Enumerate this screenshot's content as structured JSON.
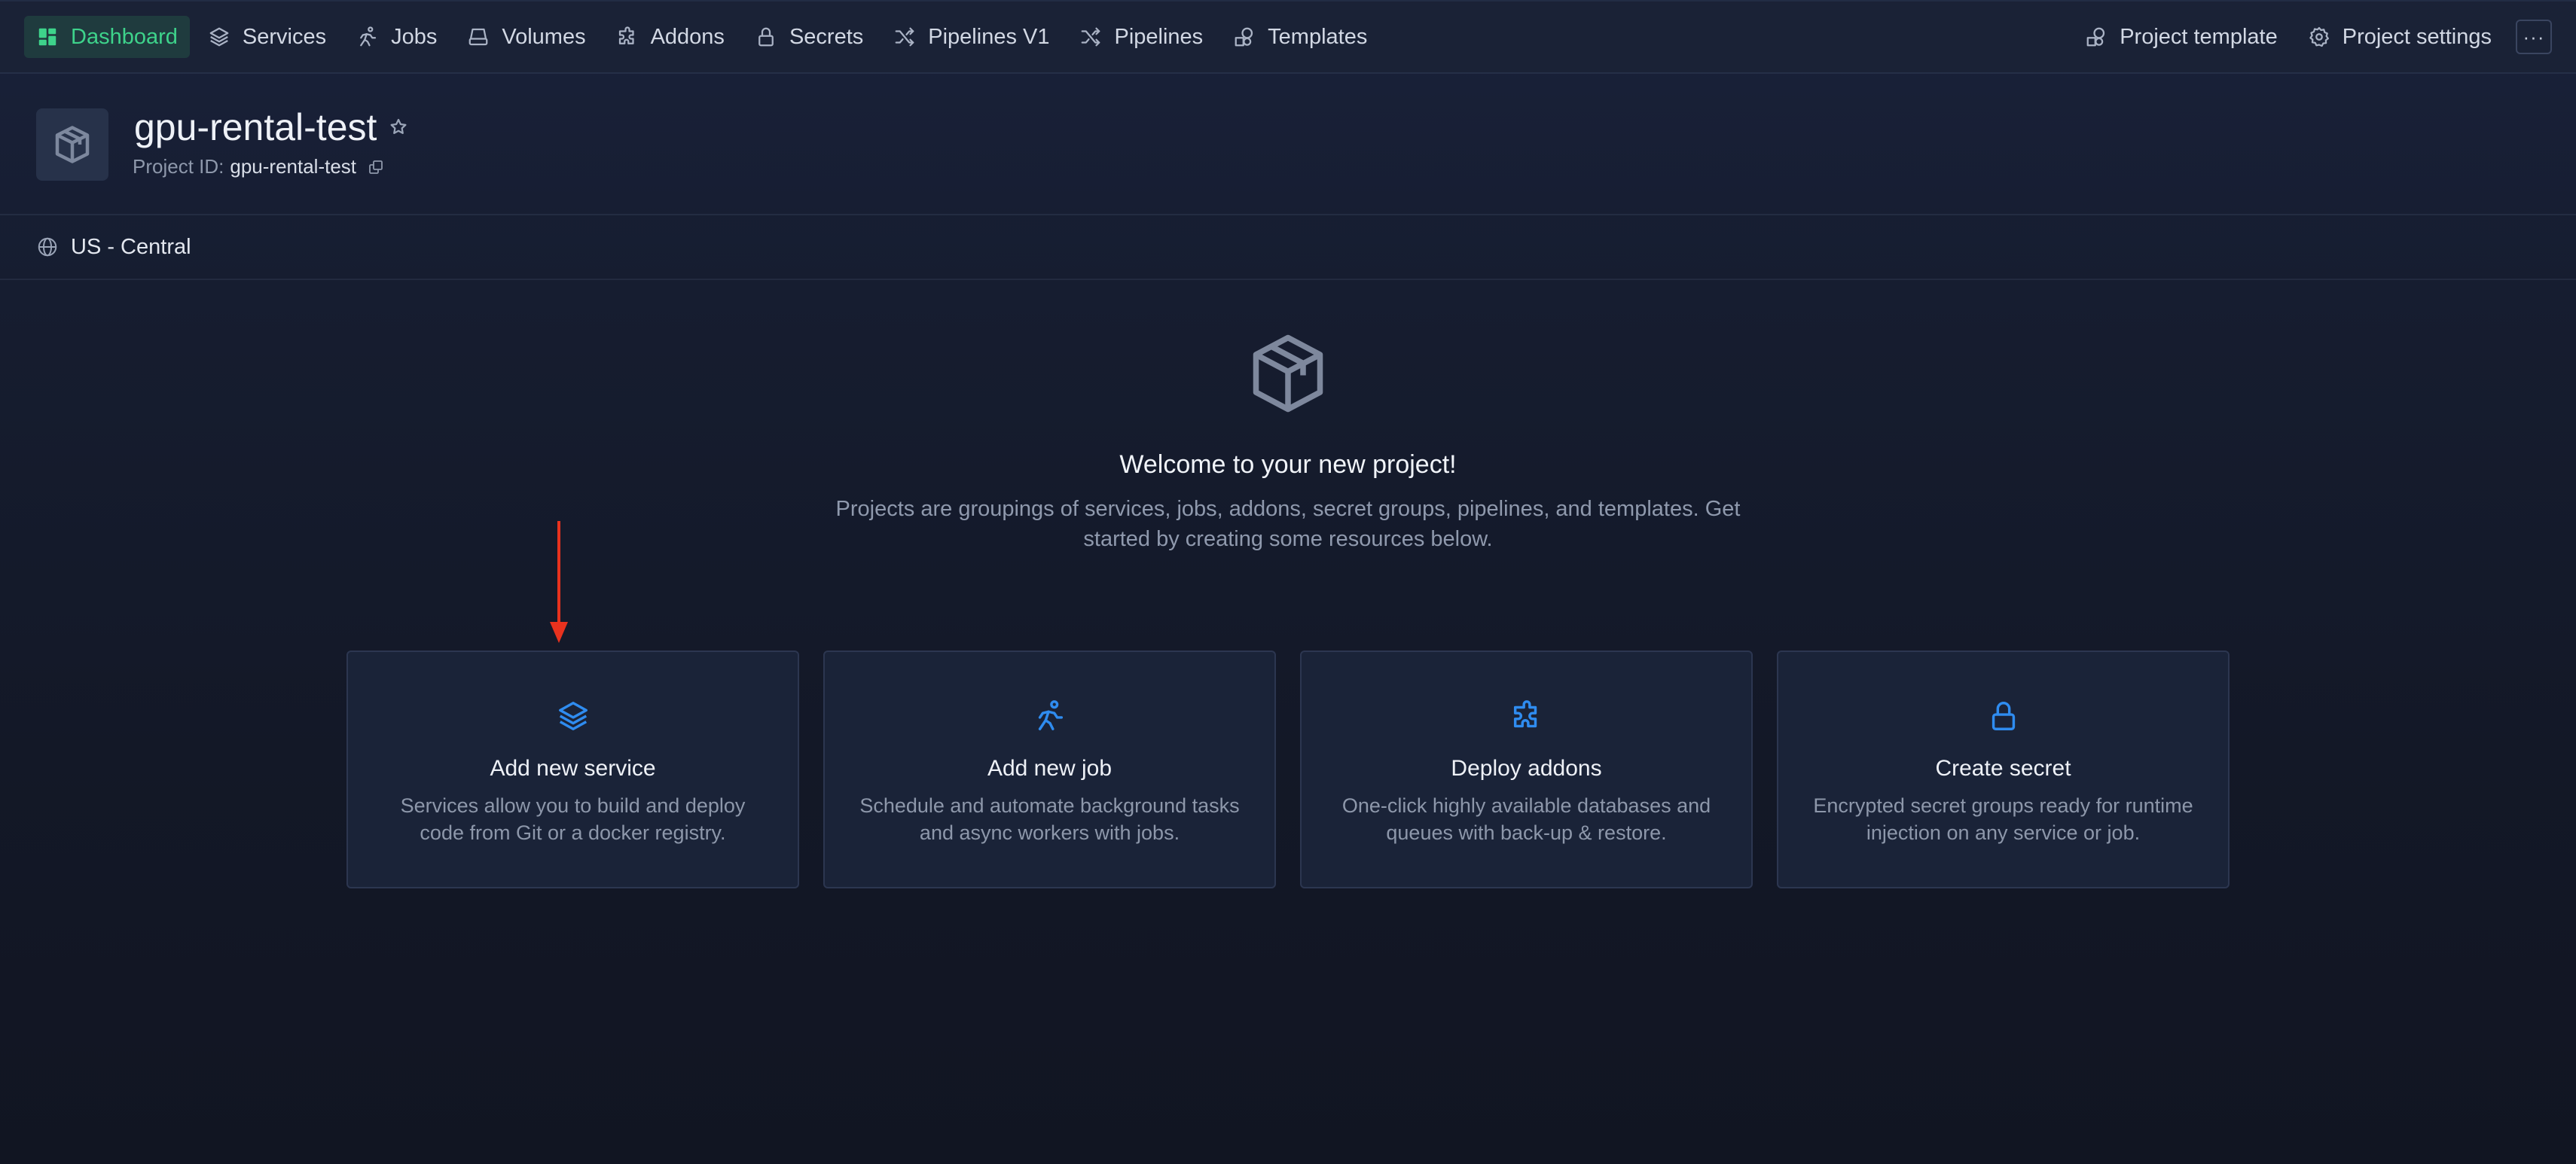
{
  "nav": {
    "left": [
      {
        "label": "Dashboard",
        "icon": "dashboard-icon",
        "active": true
      },
      {
        "label": "Services",
        "icon": "layers-icon"
      },
      {
        "label": "Jobs",
        "icon": "running-icon"
      },
      {
        "label": "Volumes",
        "icon": "drive-icon"
      },
      {
        "label": "Addons",
        "icon": "puzzle-icon"
      },
      {
        "label": "Secrets",
        "icon": "lock-icon"
      },
      {
        "label": "Pipelines V1",
        "icon": "shuffle-icon"
      },
      {
        "label": "Pipelines",
        "icon": "shuffle-icon"
      },
      {
        "label": "Templates",
        "icon": "shapes-icon"
      }
    ],
    "right": [
      {
        "label": "Project template",
        "icon": "shapes-icon"
      },
      {
        "label": "Project settings",
        "icon": "gear-icon"
      }
    ],
    "more_label": "···"
  },
  "project": {
    "name": "gpu-rental-test",
    "id_label": "Project ID:",
    "id_value": "gpu-rental-test"
  },
  "region": {
    "label": "US - Central",
    "icon": "globe-icon"
  },
  "welcome": {
    "title": "Welcome to your new project!",
    "description": "Projects are groupings of services, jobs, addons, secret groups, pipelines, and templates. Get started by creating some resources below."
  },
  "cards": [
    {
      "title": "Add new service",
      "description": "Services allow you to build and deploy code from Git or a docker registry.",
      "icon": "layers-icon"
    },
    {
      "title": "Add new job",
      "description": "Schedule and automate background tasks and async workers with jobs.",
      "icon": "running-icon"
    },
    {
      "title": "Deploy addons",
      "description": "One-click highly available databases and queues with back-up & restore.",
      "icon": "puzzle-icon"
    },
    {
      "title": "Create secret",
      "description": "Encrypted secret groups ready for runtime injection on any service or job.",
      "icon": "lock-icon"
    }
  ],
  "colors": {
    "accent_green": "#3ed38b",
    "accent_blue": "#2f8cf0",
    "annotation_arrow": "#e8321e",
    "background": "#141a29"
  }
}
